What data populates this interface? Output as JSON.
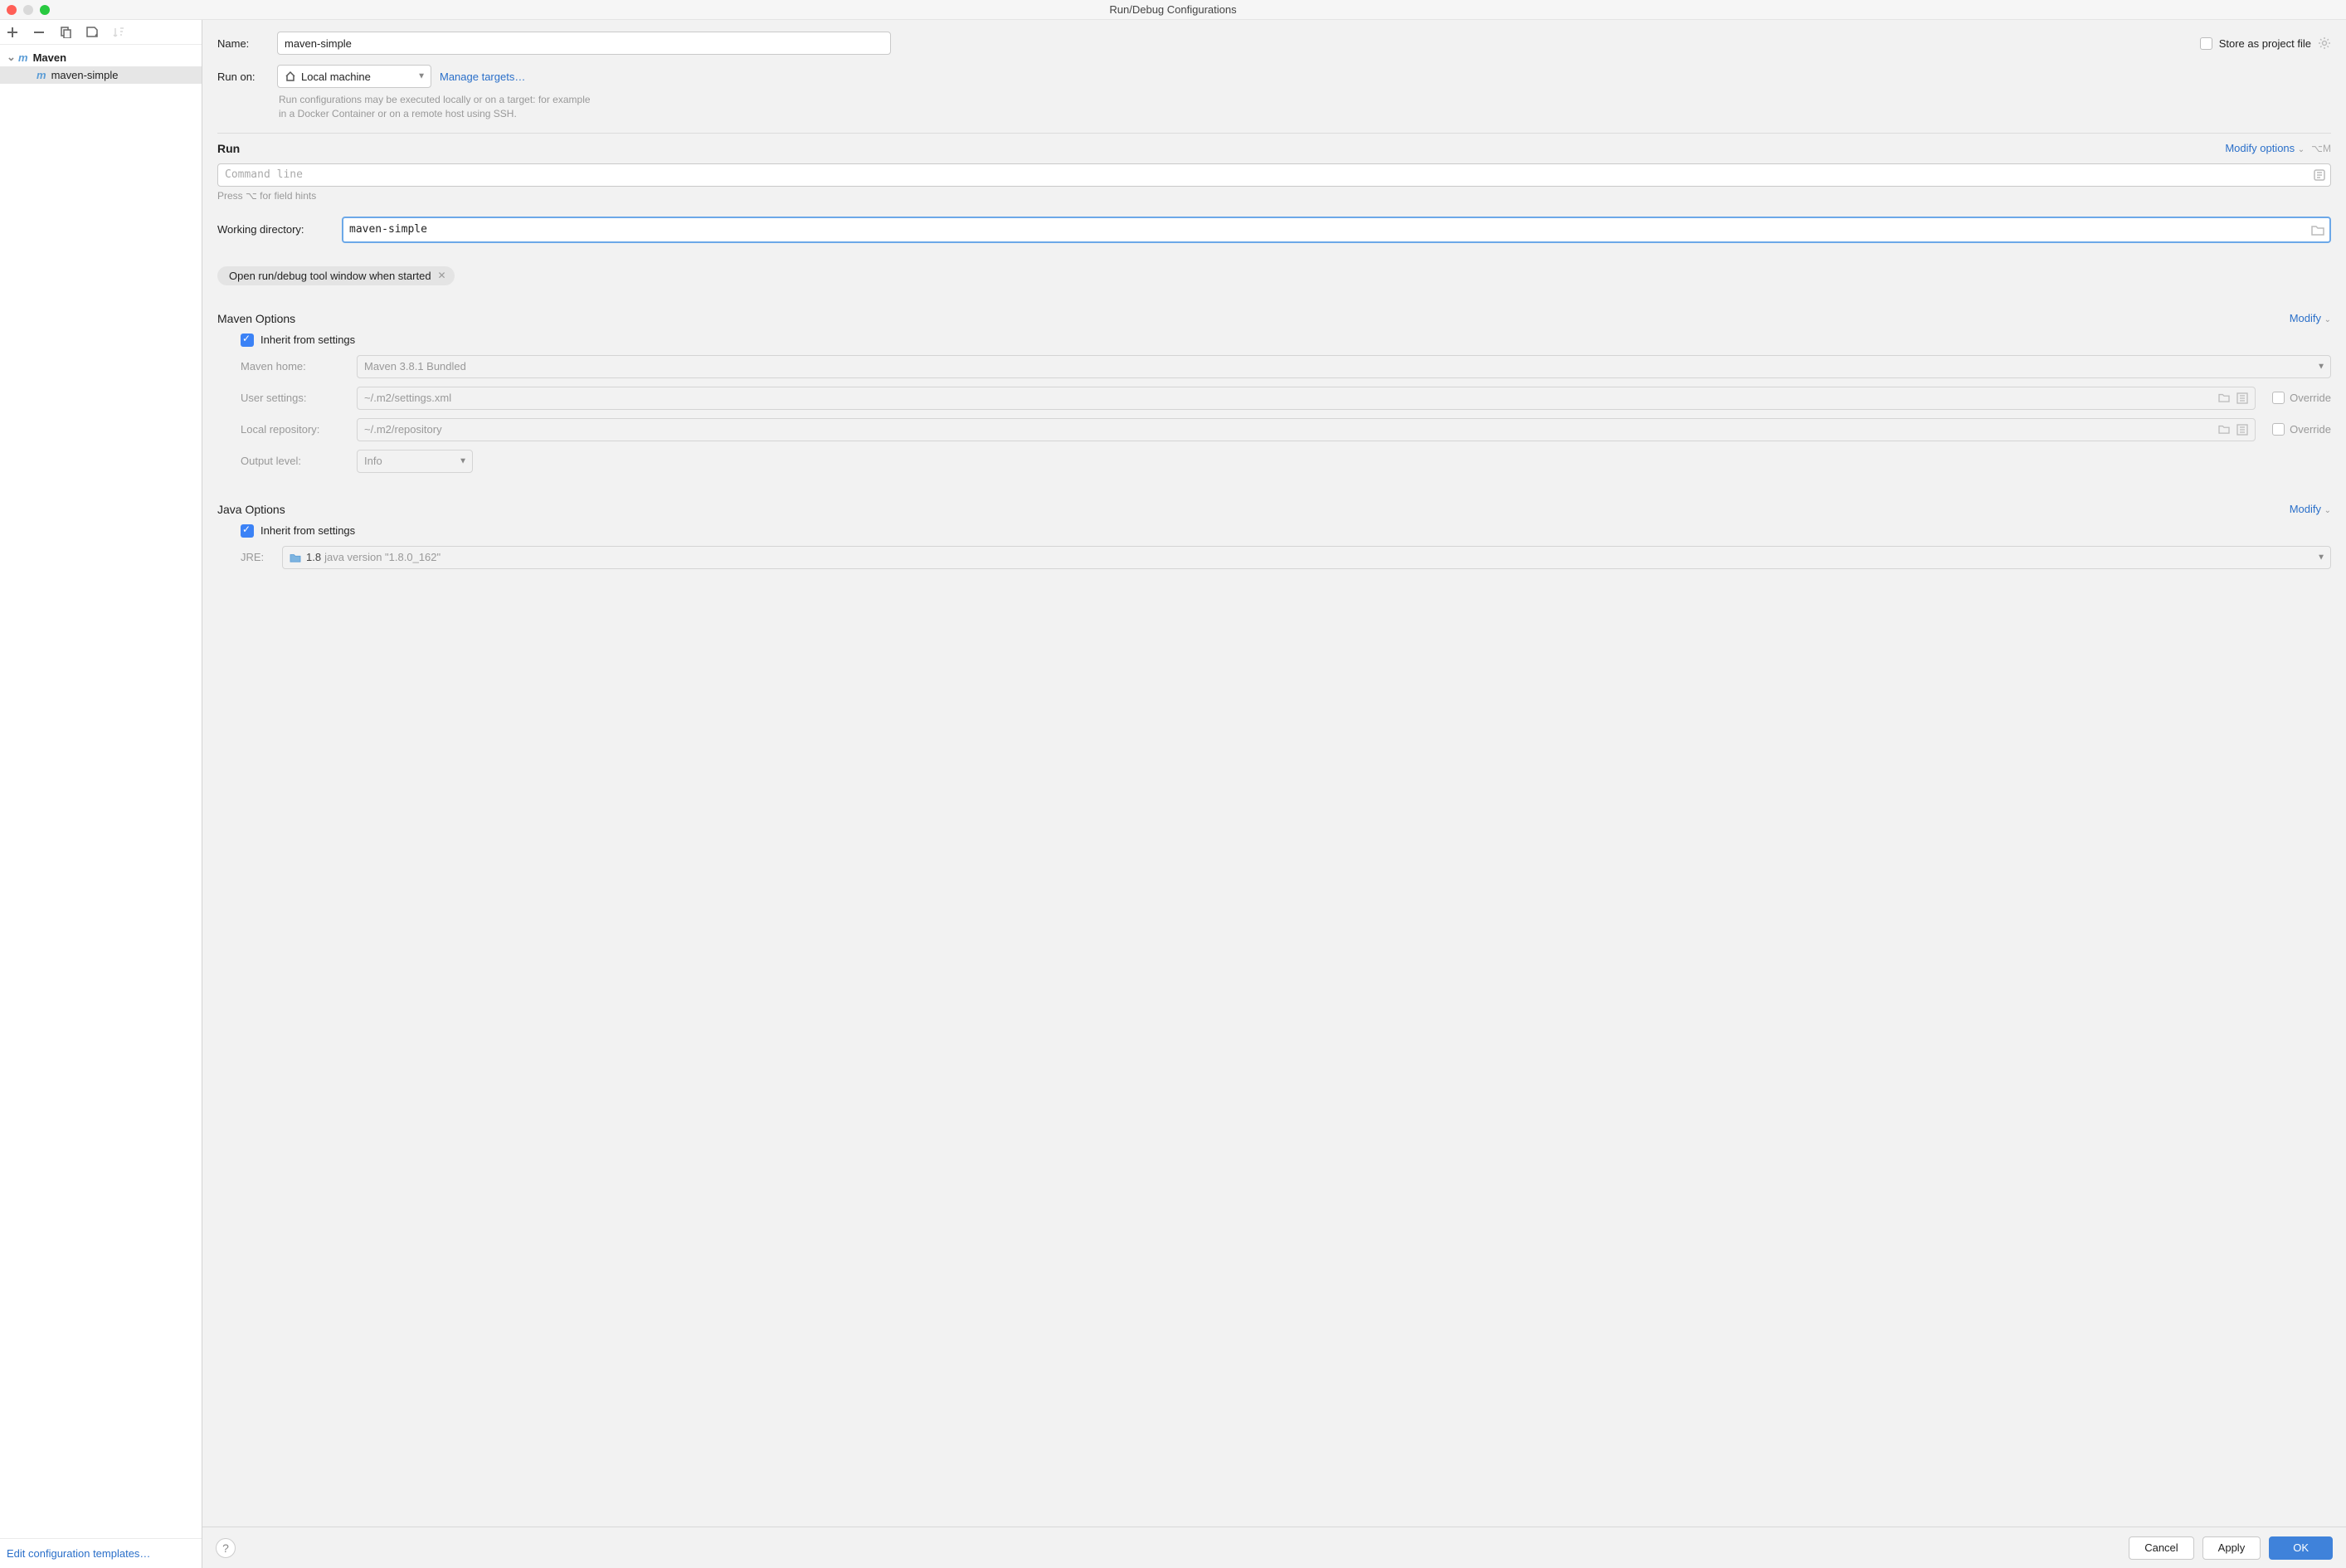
{
  "window": {
    "title": "Run/Debug Configurations"
  },
  "sidebar": {
    "root_label": "Maven",
    "item_label": "maven-simple",
    "edit_templates": "Edit configuration templates…"
  },
  "form": {
    "name_label": "Name:",
    "name_value": "maven-simple",
    "store_label": "Store as project file",
    "run_on_label": "Run on:",
    "run_on_value": "Local machine",
    "manage_targets": "Manage targets…",
    "run_on_hint1": "Run configurations may be executed locally or on a target: for example",
    "run_on_hint2": "in a Docker Container or on a remote host using SSH."
  },
  "run": {
    "header": "Run",
    "modify_options": "Modify options",
    "shortcut": "⌥M",
    "cmd_placeholder": "Command line",
    "hints": "Press ⌥ for field hints",
    "wd_label": "Working directory:",
    "wd_value": "maven-simple",
    "chip_label": "Open run/debug tool window when started"
  },
  "maven": {
    "header": "Maven Options",
    "modify": "Modify",
    "inherit_label": "Inherit from settings",
    "home_label": "Maven home:",
    "home_value": "Maven 3.8.1 Bundled",
    "user_settings_label": "User settings:",
    "user_settings_value": "~/.m2/settings.xml",
    "local_repo_label": "Local repository:",
    "local_repo_value": "~/.m2/repository",
    "override_label": "Override",
    "output_label": "Output level:",
    "output_value": "Info"
  },
  "java": {
    "header": "Java Options",
    "modify": "Modify",
    "inherit_label": "Inherit from settings",
    "jre_label": "JRE:",
    "jre_value_strong": "1.8",
    "jre_value_rest": "java version \"1.8.0_162\""
  },
  "buttons": {
    "cancel": "Cancel",
    "apply": "Apply",
    "ok": "OK"
  }
}
